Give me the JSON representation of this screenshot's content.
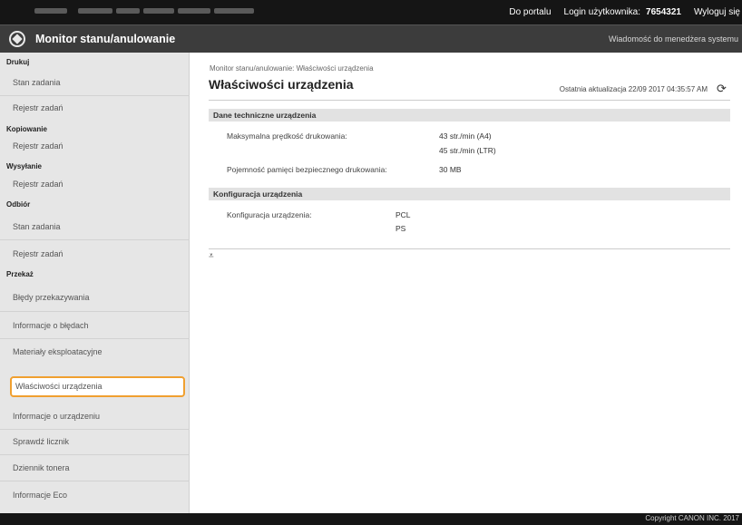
{
  "topbar": {
    "portal_link": "Do portalu",
    "login_label": "Login użytkownika:",
    "login_value": "7654321",
    "logout_link": "Wyloguj się"
  },
  "header": {
    "title": "Monitor stanu/anulowanie",
    "manager_message": "Wiadomość do menedżera systemu"
  },
  "sidebar": {
    "categories": [
      "Drukuj",
      "Kopiowanie",
      "Wysyłanie",
      "Odbiór",
      "Przekaż"
    ],
    "items": [
      "Stan zadania",
      "Rejestr zadań",
      "Rejestr zadań",
      "Rejestr zadań",
      "Stan zadania",
      "Rejestr zadań",
      "Błędy przekazywania",
      "Informacje o błędach",
      "Materiały eksploatacyjne",
      "Właściwości urządzenia",
      "Informacje o urządzeniu",
      "Sprawdź licznik",
      "Dziennik tonera",
      "Informacje Eco"
    ]
  },
  "main": {
    "breadcrumb": "Monitor stanu/anulowanie: Właściwości urządzenia",
    "title": "Właściwości urządzenia",
    "last_update": "Ostatnia aktualizacja 22/09 2017 04:35:57 AM",
    "sections": {
      "tech": {
        "heading": "Dane techniczne urządzenia",
        "max_speed_label": "Maksymalna prędkość drukowania:",
        "max_speed_values": [
          "43 str./min (A4)",
          "45 str./min (LTR)"
        ],
        "memory_label": "Pojemność pamięci bezpiecznego drukowania:",
        "memory_value": "30 MB"
      },
      "config": {
        "heading": "Konfiguracja urządzenia",
        "label": "Konfiguracja urządzenia:",
        "values": [
          "PCL",
          "PS"
        ]
      }
    }
  },
  "footer": {
    "copyright": "Copyright CANON INC. 2017"
  },
  "colors": {
    "topbar": "#151515",
    "header": "#3c3c3c",
    "sidebar": "#e6e6e6",
    "active_outline": "#f0a030",
    "section_bg": "#e2e2e2"
  }
}
